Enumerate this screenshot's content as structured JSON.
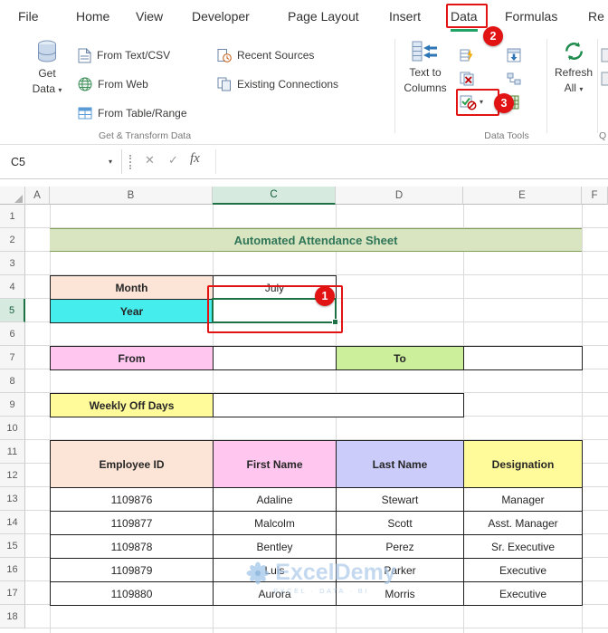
{
  "menubar": {
    "items": [
      {
        "label": "File"
      },
      {
        "label": "Home"
      },
      {
        "label": "View"
      },
      {
        "label": "Developer"
      },
      {
        "label": "Page Layout"
      },
      {
        "label": "Insert"
      },
      {
        "label": "Data",
        "selected": true
      },
      {
        "label": "Formulas"
      },
      {
        "label": "Re"
      }
    ]
  },
  "ribbon": {
    "get_data": {
      "line1": "Get",
      "line2": "Data"
    },
    "buttons": {
      "from_text_csv": "From Text/CSV",
      "from_web": "From Web",
      "from_table_range": "From Table/Range",
      "recent_sources": "Recent Sources",
      "existing_connections": "Existing Connections",
      "text_to_columns_line1": "Text to",
      "text_to_columns_line2": "Columns",
      "refresh_line1": "Refresh",
      "refresh_line2": "All"
    },
    "groups": {
      "get_transform": "Get & Transform Data",
      "data_tools": "Data Tools",
      "clipped_right": "Q"
    }
  },
  "formula_bar": {
    "name_box": "C5",
    "fx_label": "fx"
  },
  "sheet": {
    "col_headers": [
      "A",
      "B",
      "C",
      "D",
      "E",
      "F"
    ],
    "row_headers": [
      "1",
      "2",
      "3",
      "4",
      "5",
      "6",
      "7",
      "8",
      "9",
      "10",
      "11",
      "12",
      "13",
      "14",
      "15",
      "16",
      "17",
      "18"
    ],
    "title": "Automated Attendance Sheet",
    "labels": {
      "month": "Month",
      "year": "Year",
      "from": "From",
      "to": "To",
      "weekly_off": "Weekly Off Days"
    },
    "values": {
      "month": "July",
      "year": ""
    },
    "table": {
      "headers": [
        "Employee ID",
        "First Name",
        "Last Name",
        "Designation"
      ],
      "rows": [
        [
          "1109876",
          "Adaline",
          "Stewart",
          "Manager"
        ],
        [
          "1109877",
          "Malcolm",
          "Scott",
          "Asst. Manager"
        ],
        [
          "1109878",
          "Bentley",
          "Perez",
          "Sr. Executive"
        ],
        [
          "1109879",
          "Luis",
          "Parker",
          "Executive"
        ],
        [
          "1109880",
          "Aurora",
          "Morris",
          "Executive"
        ]
      ]
    },
    "active_cell": "C5"
  },
  "annotations": {
    "step1": "1",
    "step2": "2",
    "step3": "3"
  },
  "watermark": {
    "brand": "ExcelDemy",
    "tagline": "EXCEL · DATA · BI"
  },
  "colors": {
    "annotation_red": "#E21313",
    "excel_green": "#1E7145",
    "tab_underline_green": "#21A366",
    "title_bg": "#D9E5C1",
    "title_text": "#2F7558",
    "peach": "#FCE4D6",
    "cyan": "#45EDED",
    "pink": "#FFC7F0",
    "light_green": "#CBEF9B",
    "yellow": "#FFFA9A",
    "lavender": "#CBCCFA"
  }
}
